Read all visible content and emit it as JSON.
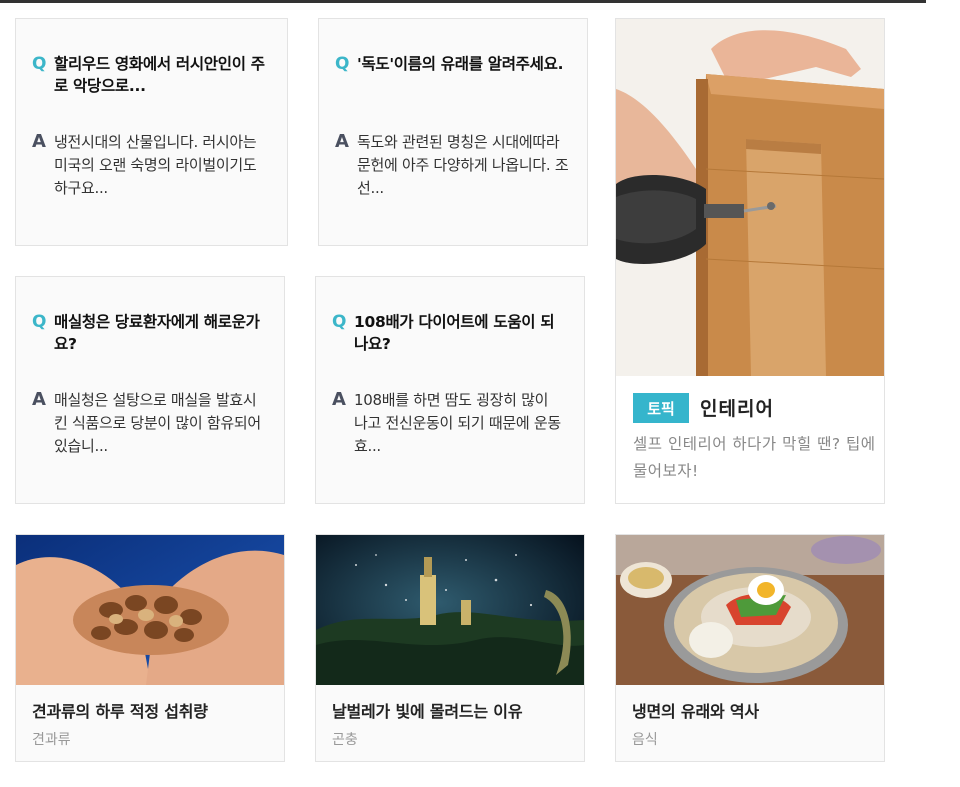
{
  "qa_cards": [
    {
      "q_mark": "Q",
      "a_mark": "A",
      "question": "할리우드 영화에서 러시안인이 주로 악당으로...",
      "answer": "냉전시대의 산물입니다. 러시아는 미국의 오랜 숙명의 라이벌이기도 하구요..."
    },
    {
      "q_mark": "Q",
      "a_mark": "A",
      "question": "'독도'이름의 유래를 알려주세요.",
      "answer": "독도와 관련된 명칭은 시대에따라 문헌에 아주 다양하게 나옵니다. 조선..."
    },
    {
      "q_mark": "Q",
      "a_mark": "A",
      "question": "매실청은 당료환자에게 해로운가요?",
      "answer": "매실청은 설탕으로 매실을 발효시킨 식품으로 당분이 많이 함유되어 있습니..."
    },
    {
      "q_mark": "Q",
      "a_mark": "A",
      "question": "108배가 다이어트에 도움이 되나요?",
      "answer": "108배를 하면 땀도 굉장히 많이 나고 전신운동이 되기 때문에 운동 효..."
    }
  ],
  "topic_card": {
    "badge": "토픽",
    "title": "인테리어",
    "description": "셀프 인테리어 하다가 막힐 땐? 팁에 물어보자!"
  },
  "image_cards": [
    {
      "title": "견과류의 하루 적정 섭취량",
      "category": "견과류"
    },
    {
      "title": "날벌레가 빛에 몰려드는 이유",
      "category": "곤충"
    },
    {
      "title": "냉면의 유래와 역사",
      "category": "음식"
    }
  ],
  "icons": {
    "q_color": "#3cb6c9",
    "a_color": "#4a5060",
    "badge_color": "#35b5cc"
  }
}
